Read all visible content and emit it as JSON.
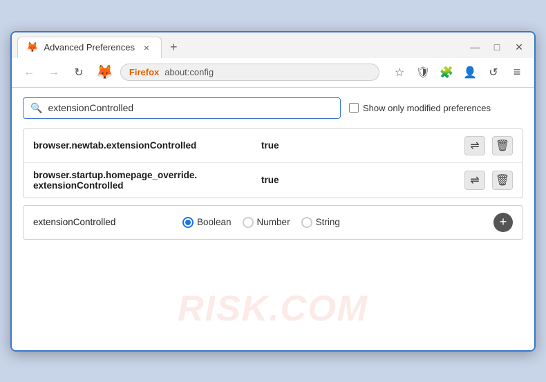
{
  "window": {
    "title": "Advanced Preferences",
    "tab_close": "×",
    "new_tab": "+",
    "minimize": "—",
    "maximize": "□",
    "close": "✕"
  },
  "nav": {
    "back": "←",
    "forward": "→",
    "reload": "↻",
    "browser_name": "Firefox",
    "url": "about:config",
    "star": "☆",
    "shield": "⛨",
    "extension": "🧩",
    "profile": "👤",
    "sync": "↺",
    "menu": "≡"
  },
  "search": {
    "placeholder": "extensionControlled",
    "value": "extensionControlled",
    "show_modified_label": "Show only modified preferences"
  },
  "results": [
    {
      "name": "browser.newtab.extensionControlled",
      "value": "true"
    },
    {
      "name": "browser.startup.homepage_override.\nextensionControlled",
      "name_line1": "browser.startup.homepage_override.",
      "name_line2": "extensionControlled",
      "value": "true",
      "multiline": true
    }
  ],
  "add_pref": {
    "name": "extensionControlled",
    "types": [
      "Boolean",
      "Number",
      "String"
    ],
    "selected_type": "Boolean",
    "add_label": "+"
  },
  "watermark": "RISK.COM",
  "icons": {
    "search": "🔍",
    "reset": "⇌",
    "delete": "🗑",
    "add": "+"
  }
}
